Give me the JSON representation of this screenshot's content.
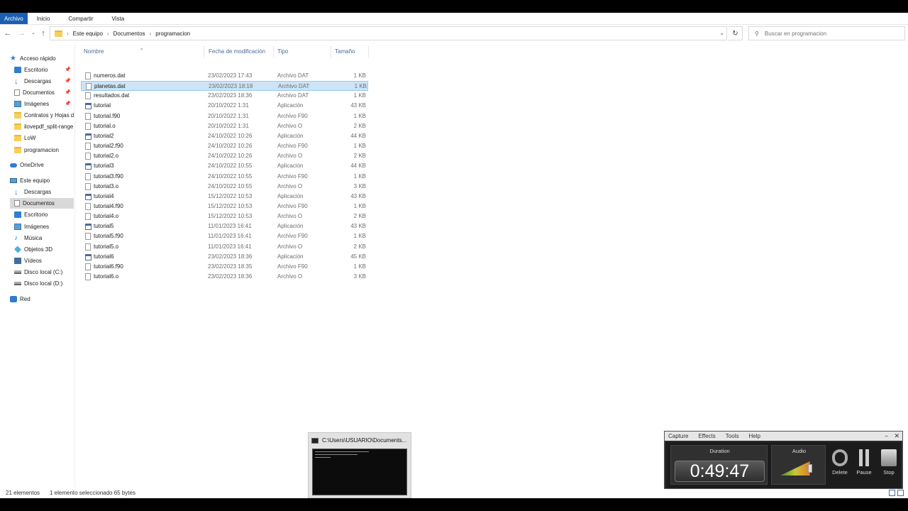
{
  "ribbon": {
    "tabs": [
      "Archivo",
      "Inicio",
      "Compartir",
      "Vista"
    ]
  },
  "address": {
    "crumbs": [
      "Este equipo",
      "Documentos",
      "programacion"
    ],
    "search_placeholder": "Buscar en programacion"
  },
  "nav": {
    "items": [
      "Acceso rápido",
      "Escritorio",
      "Descargas",
      "Documentos",
      "Imágenes",
      "Contratos y Hojas d",
      "ilovepdf_split-range",
      "LoW",
      "programacion",
      "OneDrive",
      "Este equipo",
      "Descargas",
      "Documentos",
      "Escritorio",
      "Imágenes",
      "Música",
      "Objetos 3D",
      "Vídeos",
      "Disco local (C:)",
      "Disco local (D:)",
      "Red"
    ]
  },
  "files": {
    "headers": {
      "name": "Nombre",
      "date": "Fecha de modificación",
      "type": "Tipo",
      "size": "Tamaño"
    },
    "rows": [
      {
        "name": "numeros.dat",
        "date": "23/02/2023 17:43",
        "type": "Archivo DAT",
        "size": "1 KB"
      },
      {
        "name": "planetas.dat",
        "date": "23/02/2023 18:18",
        "type": "Archivo DAT",
        "size": "1 KB"
      },
      {
        "name": "resultados.dat",
        "date": "23/02/2023 18:36",
        "type": "Archivo DAT",
        "size": "1 KB"
      },
      {
        "name": "tutorial",
        "date": "20/10/2022 1:31",
        "type": "Aplicación",
        "size": "43 KB"
      },
      {
        "name": "tutorial.f90",
        "date": "20/10/2022 1:31",
        "type": "Archivo F90",
        "size": "1 KB"
      },
      {
        "name": "tutorial.o",
        "date": "20/10/2022 1:31",
        "type": "Archivo O",
        "size": "2 KB"
      },
      {
        "name": "tutorial2",
        "date": "24/10/2022 10:26",
        "type": "Aplicación",
        "size": "44 KB"
      },
      {
        "name": "tutorial2.f90",
        "date": "24/10/2022 10:26",
        "type": "Archivo F90",
        "size": "1 KB"
      },
      {
        "name": "tutorial2.o",
        "date": "24/10/2022 10:26",
        "type": "Archivo O",
        "size": "2 KB"
      },
      {
        "name": "tutorial3",
        "date": "24/10/2022 10:55",
        "type": "Aplicación",
        "size": "44 KB"
      },
      {
        "name": "tutorial3.f90",
        "date": "24/10/2022 10:55",
        "type": "Archivo F90",
        "size": "1 KB"
      },
      {
        "name": "tutorial3.o",
        "date": "24/10/2022 10:55",
        "type": "Archivo O",
        "size": "3 KB"
      },
      {
        "name": "tutorial4",
        "date": "15/12/2022 10:53",
        "type": "Aplicación",
        "size": "43 KB"
      },
      {
        "name": "tutorial4.f90",
        "date": "15/12/2022 10:53",
        "type": "Archivo F90",
        "size": "1 KB"
      },
      {
        "name": "tutorial4.o",
        "date": "15/12/2022 10:53",
        "type": "Archivo O",
        "size": "2 KB"
      },
      {
        "name": "tutorial5",
        "date": "11/01/2023 16:41",
        "type": "Aplicación",
        "size": "43 KB"
      },
      {
        "name": "tutorial5.f90",
        "date": "11/01/2023 16:41",
        "type": "Archivo F90",
        "size": "1 KB"
      },
      {
        "name": "tutorial5.o",
        "date": "11/01/2023 16:41",
        "type": "Archivo O",
        "size": "2 KB"
      },
      {
        "name": "tutorial6",
        "date": "23/02/2023 18:36",
        "type": "Aplicación",
        "size": "45 KB"
      },
      {
        "name": "tutorial6.f90",
        "date": "23/02/2023 18:35",
        "type": "Archivo F90",
        "size": "1 KB"
      },
      {
        "name": "tutorial6.o",
        "date": "23/02/2023 18:36",
        "type": "Archivo O",
        "size": "3 KB"
      }
    ]
  },
  "status": {
    "count": "21 elementos",
    "selection": "1 elemento seleccionado  65 bytes"
  },
  "thumbnail": {
    "title": "C:\\Users\\USUARIO\\Documents..."
  },
  "recorder": {
    "menu": [
      "Capture",
      "Effects",
      "Tools",
      "Help"
    ],
    "duration_label": "Duration",
    "duration_value": "0:49:47",
    "audio_label": "Audio",
    "audio_level": 0.8,
    "delete_label": "Delete",
    "pause_label": "Pause",
    "stop_label": "Stop"
  }
}
